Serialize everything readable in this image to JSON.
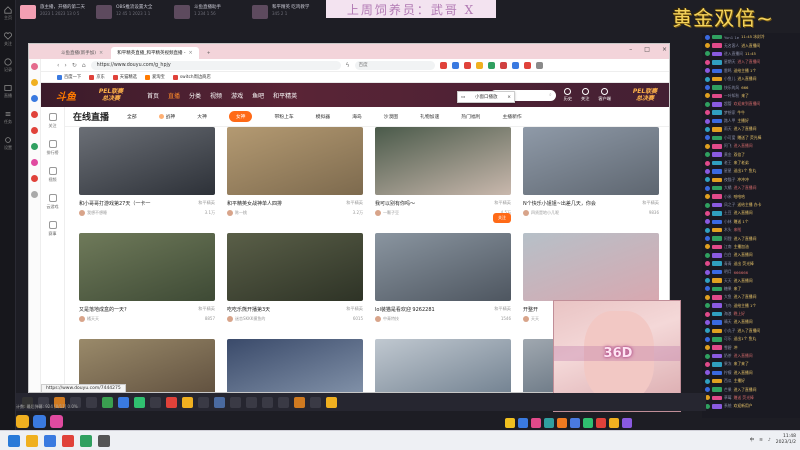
{
  "rail": {
    "items": [
      "主页",
      "关注",
      "记录",
      "直播",
      "任务",
      "设置"
    ]
  },
  "strip": {
    "streams": [
      {
        "title": "旅主播，开播的第二天",
        "meta": "2023 1 2023 13 0 5"
      },
      {
        "title": "OBS推流设置大全",
        "meta": "12 45 1 2023 1 1"
      },
      {
        "title": "斗鱼直播助手",
        "meta": "1 234 1 56"
      },
      {
        "title": "和平精英 吃鸡教学",
        "meta": "345 2 1"
      }
    ],
    "banner": "上周饲养员：武哥 X",
    "gold": "黄金双倍~"
  },
  "browser": {
    "tabs": [
      {
        "label": "斗鱼直播(新手加)"
      },
      {
        "label": "和平精英直播_和平精英视频直播 -"
      },
      {
        "label": "+"
      }
    ],
    "url": "https://www.douyu.com/g_hpjy",
    "search_placeholder": "百度",
    "bookmarks": [
      "百度一下",
      "京东",
      "天猫精选",
      "爱淘宝",
      "switch周边商店"
    ],
    "status_url": "https://www.douyu.com/7444275"
  },
  "douyu": {
    "logo": "斗鱼",
    "pel1": [
      "PEL联赛",
      "总决赛"
    ],
    "pel2": [
      "PEL联赛",
      "总决赛"
    ],
    "nav": [
      "首页",
      "直播",
      "分类",
      "视频",
      "游戏",
      "鱼吧",
      "和平精英"
    ],
    "active_nav": "直播",
    "search_placeholder": "搜索",
    "icons": [
      "历史",
      "关注",
      "客户端"
    ],
    "left_nav": [
      "关注",
      "排行榜",
      "视频",
      "云游戏",
      "赛事"
    ],
    "category_title": "在线直播",
    "categories": [
      "全部",
      "战神",
      "大神",
      "女神",
      "带粉上车",
      "模拟器",
      "海岛",
      "沙漠图",
      "礼物加速",
      "热门福利",
      "主播新作"
    ],
    "active_category": "女神",
    "mini_window": "小窗口播放"
  },
  "cards": [
    {
      "title": "和小哥哥打游戏第27天（一卡一",
      "cat": "和平精英",
      "streamer": "我想不想睡",
      "viewers": "3.1万",
      "followbtn": ""
    },
    {
      "title": "和平精英女战神单人四排",
      "cat": "和平精英",
      "streamer": "陈一桃",
      "viewers": "3.2万",
      "followbtn": ""
    },
    {
      "title": "我可以别有你吗～",
      "cat": "和平精英",
      "streamer": "一颗子豆",
      "viewers": "4.5万",
      "followbtn": "关注"
    },
    {
      "title": "N个快乐小姐姐~出差几天，你会",
      "cat": "和平精英",
      "streamer": "四贤是地小几呢",
      "viewers": "9836",
      "followbtn": ""
    },
    {
      "title": "又是落地成盒的一天?",
      "cat": "和平精英",
      "streamer": "橘天天",
      "viewers": "8857",
      "followbtn": ""
    },
    {
      "title": "吃吃乐熊开播第3天",
      "cat": "和平精英",
      "streamer": "迷恋SKKK摸鱼的",
      "viewers": "6015",
      "followbtn": ""
    },
    {
      "title": "lol装猫是看欢迎 9262281",
      "cat": "和平精英",
      "streamer": "中青特技",
      "viewers": "1546",
      "followbtn": ""
    },
    {
      "title": "开整开",
      "cat": "",
      "streamer": "天天",
      "viewers": "",
      "followbtn": ""
    },
    {
      "title": "",
      "cat": "",
      "streamer": "",
      "viewers": "",
      "followbtn": ""
    },
    {
      "title": "",
      "cat": "",
      "streamer": "",
      "viewers": "",
      "followbtn": ""
    },
    {
      "title": "",
      "cat": "",
      "streamer": "",
      "viewers": "",
      "followbtn": ""
    },
    {
      "title": "",
      "cat": "",
      "streamer": "",
      "viewers": "",
      "followbtn": ""
    }
  ],
  "cam_label": "36D",
  "chat": [
    {
      "user": "Yun1 1e",
      "msg": "11:45  冰封冷"
    },
    {
      "user": "无名客人",
      "msg": "进入直播间"
    },
    {
      "user": "进入直播间",
      "msg": "11:45"
    },
    {
      "user": "星期天",
      "msg": "进入了直播间"
    },
    {
      "user": "雷鸣",
      "msg": "送给主播 1个"
    },
    {
      "user": "小鱼儿",
      "msg": "进入直播间"
    },
    {
      "user": "快乐的风",
      "msg": "666"
    },
    {
      "user": "一叶知秋",
      "msg": "来了"
    },
    {
      "user": "超管",
      "msg": "欢迎来到直播间"
    },
    {
      "user": "梦想家",
      "msg": "牛牛"
    },
    {
      "user": "路人甲",
      "msg": "主播好"
    },
    {
      "user": "雨天",
      "msg": "进入了直播间"
    },
    {
      "user": "小可爱",
      "msg": "赠送了 荧光棒"
    },
    {
      "user": "阿飞",
      "msg": "进入直播间"
    },
    {
      "user": "黄金",
      "msg": "双倍了"
    },
    {
      "user": "老王",
      "msg": "来了老弟"
    },
    {
      "user": "星星",
      "msg": "送出1个 鱼丸"
    },
    {
      "user": "夜猫子",
      "msg": "冲冲冲"
    },
    {
      "user": "大橘",
      "msg": "进入了直播间"
    },
    {
      "user": "小米",
      "msg": "哈哈哈"
    },
    {
      "user": "风之子",
      "msg": "送给主播 办卡"
    },
    {
      "user": "土豆",
      "msg": "进入直播间"
    },
    {
      "user": "小林",
      "msg": "赠送 1个"
    },
    {
      "user": "木头",
      "msg": "来啦"
    },
    {
      "user": "阿狸",
      "msg": "进入了直播间"
    },
    {
      "user": "江南",
      "msg": "主播加油"
    },
    {
      "user": "白白",
      "msg": "进入直播间"
    },
    {
      "user": "青青",
      "msg": "送出 荧光棒"
    },
    {
      "user": "明月",
      "msg": "666666"
    },
    {
      "user": "天天",
      "msg": "进入直播间"
    },
    {
      "user": "糖果",
      "msg": "来了"
    },
    {
      "user": "大鱼",
      "msg": "进入了直播间"
    },
    {
      "user": "飞鸟",
      "msg": "送给主播 1个"
    },
    {
      "user": "海浪",
      "msg": "晚上好"
    },
    {
      "user": "晴天",
      "msg": "进入直播间"
    },
    {
      "user": "小丸子",
      "msg": "进入了直播间"
    },
    {
      "user": "可乐",
      "msg": "送出1个 鱼丸"
    },
    {
      "user": "雪碧",
      "msg": "冲"
    },
    {
      "user": "奶茶",
      "msg": "进入直播间"
    },
    {
      "user": "果冻",
      "msg": "来了来了"
    },
    {
      "user": "柠檬",
      "msg": "进入直播间"
    },
    {
      "user": "西瓜",
      "msg": "主播好"
    },
    {
      "user": "芒果",
      "msg": "进入了直播间"
    },
    {
      "user": "草莓",
      "msg": "赠送 荧光棒"
    },
    {
      "user": "系统",
      "msg": "欢迎新用户"
    }
  ],
  "obs_info": "计数: 最后弹幕: 924 [0/11] 0.0%",
  "tray": {
    "time": "11:48",
    "date": "2023/1/2",
    "lang": "中"
  }
}
